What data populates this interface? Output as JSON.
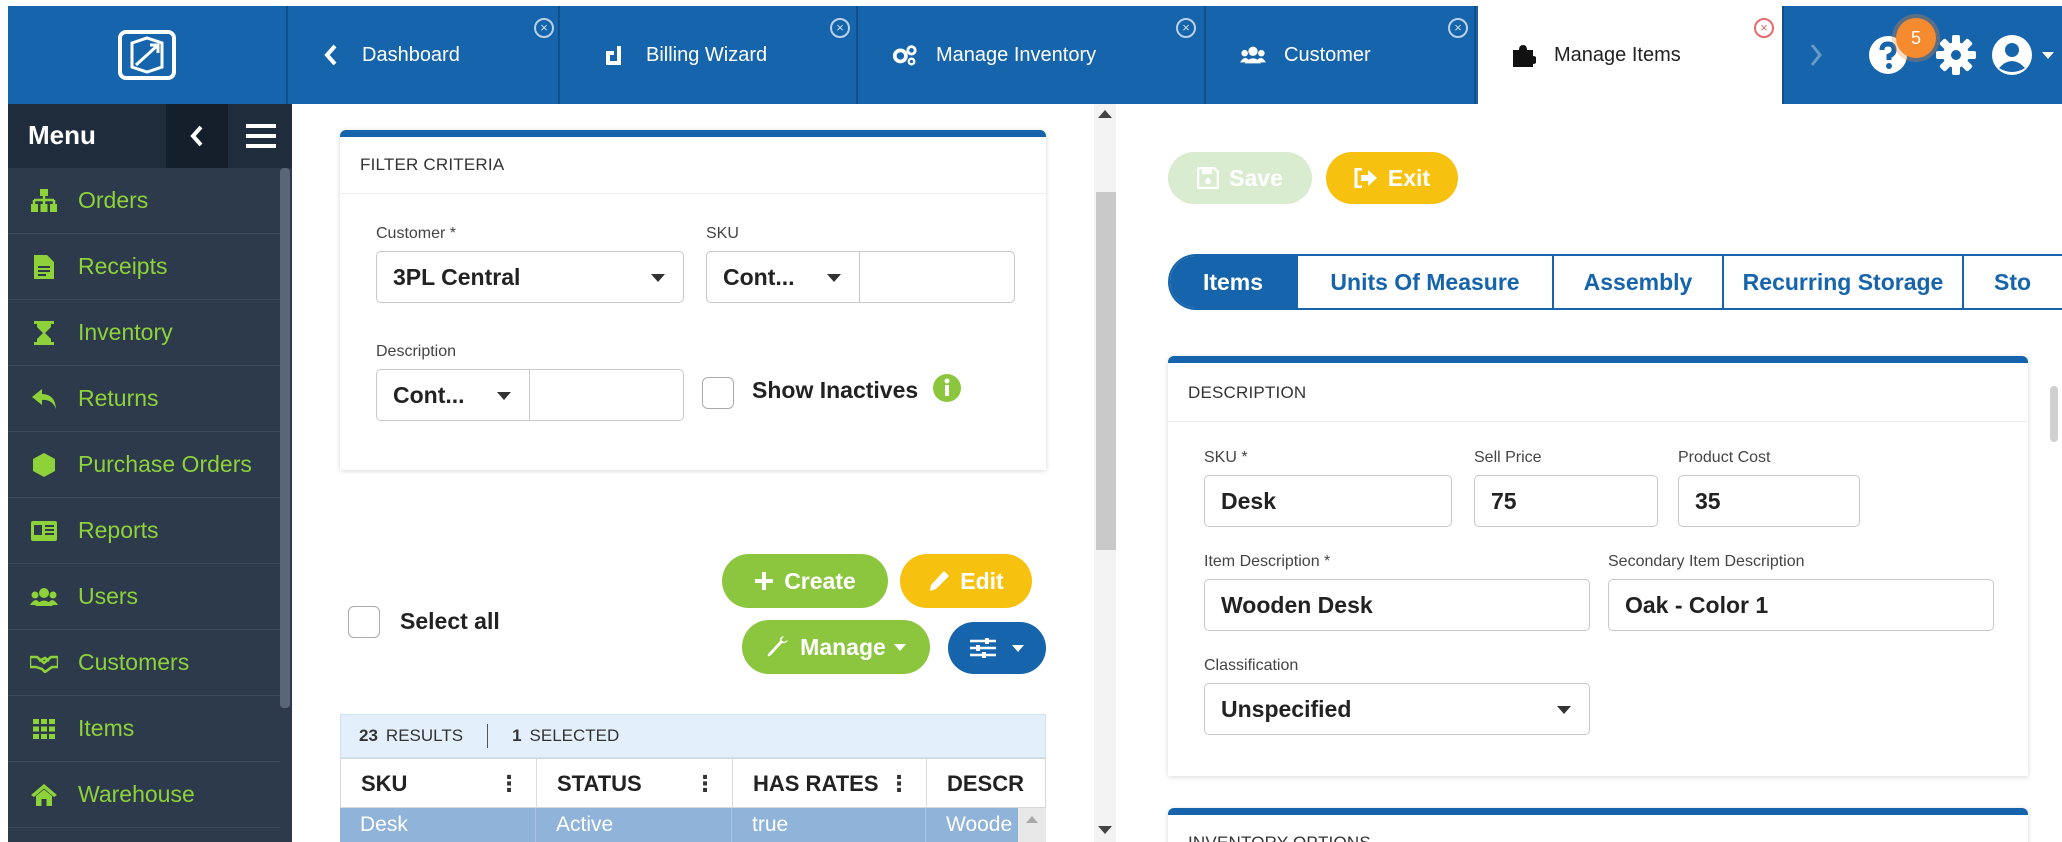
{
  "topbar": {
    "tabs": [
      {
        "label": "Dashboard",
        "icon": "chevron-left-icon"
      },
      {
        "label": "Billing Wizard",
        "icon": "billing-icon"
      },
      {
        "label": "Manage Inventory",
        "icon": "cogs-icon"
      },
      {
        "label": "Customer",
        "icon": "users-icon"
      },
      {
        "label": "Manage Items",
        "icon": "puzzle-icon",
        "active": true
      }
    ],
    "close_glyph": "×",
    "notification_count": "5"
  },
  "sidebar": {
    "title": "Menu",
    "items": [
      {
        "label": "Orders",
        "icon": "sitemap-icon"
      },
      {
        "label": "Receipts",
        "icon": "file-icon"
      },
      {
        "label": "Inventory",
        "icon": "hourglass-icon"
      },
      {
        "label": "Returns",
        "icon": "reply-icon"
      },
      {
        "label": "Purchase Orders",
        "icon": "hexagon-icon"
      },
      {
        "label": "Reports",
        "icon": "report-card-icon"
      },
      {
        "label": "Users",
        "icon": "users-icon"
      },
      {
        "label": "Customers",
        "icon": "handshake-icon"
      },
      {
        "label": "Items",
        "icon": "grid-icon"
      },
      {
        "label": "Warehouse",
        "icon": "home-icon"
      }
    ],
    "accent": "#8ed23a"
  },
  "filter": {
    "title": "FILTER CRITERIA",
    "customer_label": "Customer *",
    "customer_value": "3PL Central",
    "sku_label": "SKU",
    "sku_operator": "Cont...",
    "sku_value": "",
    "description_label": "Description",
    "description_operator": "Cont...",
    "description_value": "",
    "show_inactives_label": "Show Inactives"
  },
  "actions": {
    "create_label": "Create",
    "edit_label": "Edit",
    "manage_label": "Manage",
    "select_all_label": "Select all"
  },
  "grid": {
    "results_count": "23",
    "results_label": "RESULTS",
    "selected_count": "1",
    "selected_label": "SELECTED",
    "columns": [
      "SKU",
      "STATUS",
      "HAS RATES",
      "DESCR"
    ],
    "rows": [
      [
        "Desk",
        "Active",
        "true",
        "Woode"
      ]
    ]
  },
  "item_form": {
    "save_label": "Save",
    "exit_label": "Exit",
    "tabs": [
      "Items",
      "Units Of Measure",
      "Assembly",
      "Recurring Storage",
      "Sto"
    ],
    "description_title": "DESCRIPTION",
    "sku_label": "SKU *",
    "sku_value": "Desk",
    "sell_price_label": "Sell Price",
    "sell_price_value": "75",
    "product_cost_label": "Product Cost",
    "product_cost_value": "35",
    "item_description_label": "Item Description *",
    "item_description_value": "Wooden Desk",
    "secondary_description_label": "Secondary Item Description",
    "secondary_description_value": "Oak - Color 1",
    "classification_label": "Classification",
    "classification_value": "Unspecified",
    "inventory_options_title": "INVENTORY OPTIONS"
  },
  "colors": {
    "brand_blue": "#1664ac",
    "green": "#8cc63f",
    "yellow": "#f6c10f",
    "sidebar_bg": "#2c3a4b"
  }
}
